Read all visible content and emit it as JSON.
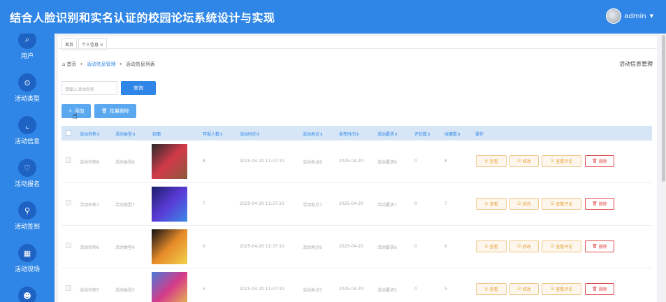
{
  "header": {
    "title": "结合人脸识别和实名认证的校园论坛系统设计与实现",
    "username": "admin"
  },
  "sidebar": {
    "items": [
      {
        "label": "用户",
        "icon": "search-icon",
        "glyph": "⌕"
      },
      {
        "label": "活动类型",
        "icon": "circle-target-icon",
        "glyph": "⊙"
      },
      {
        "label": "活动信息",
        "icon": "chart-icon",
        "glyph": "⌞"
      },
      {
        "label": "活动报名",
        "icon": "heart-icon",
        "glyph": "♡"
      },
      {
        "label": "活动签到",
        "icon": "user-icon",
        "glyph": "⚲"
      },
      {
        "label": "活动现场",
        "icon": "calendar-icon",
        "glyph": "▦"
      },
      {
        "label": "",
        "icon": "face-icon",
        "glyph": "☻"
      }
    ]
  },
  "tabs": [
    {
      "label": "首页"
    },
    {
      "label": "个人信息"
    }
  ],
  "breadcrumb": {
    "home": "首页",
    "section": "活动信息管理",
    "current": "活动信息列表"
  },
  "page_heading": "活动信息管理",
  "search": {
    "placeholder": "请输入活动名称",
    "button": "查询"
  },
  "toolbar": {
    "add": "添加",
    "batch_delete": "批量删除"
  },
  "table": {
    "columns": [
      "活动名称",
      "活动类型",
      "封面",
      "可报人数",
      "活动时间",
      "活动地点",
      "发布时间",
      "活动要求",
      "评论数",
      "收藏数",
      "操作"
    ],
    "actions": {
      "view": "查看",
      "edit": "修改",
      "comments": "查看评论",
      "delete": "删除"
    },
    "rows": [
      {
        "name": "活动名称8",
        "type": "活动类型8",
        "capacity": "8",
        "time": "2025-04-20 11:37:10",
        "place": "活动地点8",
        "published": "2025-04-20",
        "requirement": "活动要求8",
        "comments": "0",
        "favorites": "8",
        "cover_colors": [
          "#2a2a2a",
          "#d23a4a",
          "#8a5a3a"
        ]
      },
      {
        "name": "活动名称7",
        "type": "活动类型7",
        "capacity": "7",
        "time": "2025-04-20 11:37:10",
        "place": "活动地点7",
        "published": "2025-04-20",
        "requirement": "活动要求7",
        "comments": "0",
        "favorites": "7",
        "cover_colors": [
          "#1b1f6a",
          "#5a3ad6",
          "#3a8ae6"
        ]
      },
      {
        "name": "活动名称6",
        "type": "活动类型6",
        "capacity": "6",
        "time": "2025-04-20 11:37:10",
        "place": "活动地点6",
        "published": "2025-04-20",
        "requirement": "活动要求6",
        "comments": "0",
        "favorites": "6",
        "cover_colors": [
          "#0e0e12",
          "#e68a2a",
          "#f2d24a"
        ]
      },
      {
        "name": "活动名称5",
        "type": "活动类型5",
        "capacity": "5",
        "time": "2025-04-20 11:37:10",
        "place": "活动地点5",
        "published": "2025-04-20",
        "requirement": "活动要求5",
        "comments": "0",
        "favorites": "5",
        "cover_colors": [
          "#4a7ad6",
          "#d63a8a",
          "#e6c24a"
        ]
      }
    ]
  }
}
